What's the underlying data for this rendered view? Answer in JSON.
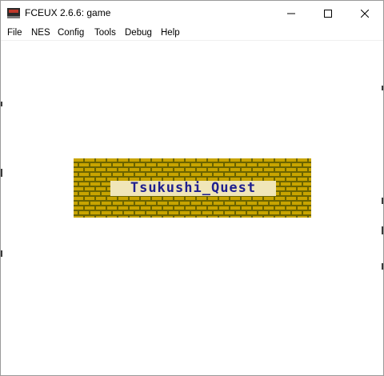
{
  "window": {
    "title": "FCEUX 2.6.6: game",
    "app_icon": "fceux-icon",
    "controls": [
      "minimize-icon",
      "maximize-icon",
      "close-icon"
    ]
  },
  "menu": {
    "items": [
      "File",
      "NES",
      "Config",
      "Tools",
      "Debug",
      "Help"
    ]
  },
  "game": {
    "title_text": "Tsukushi_Quest",
    "brick_color": "#c8a400",
    "mortar_color": "#6b6400",
    "text_color": "#1f1f8f"
  }
}
